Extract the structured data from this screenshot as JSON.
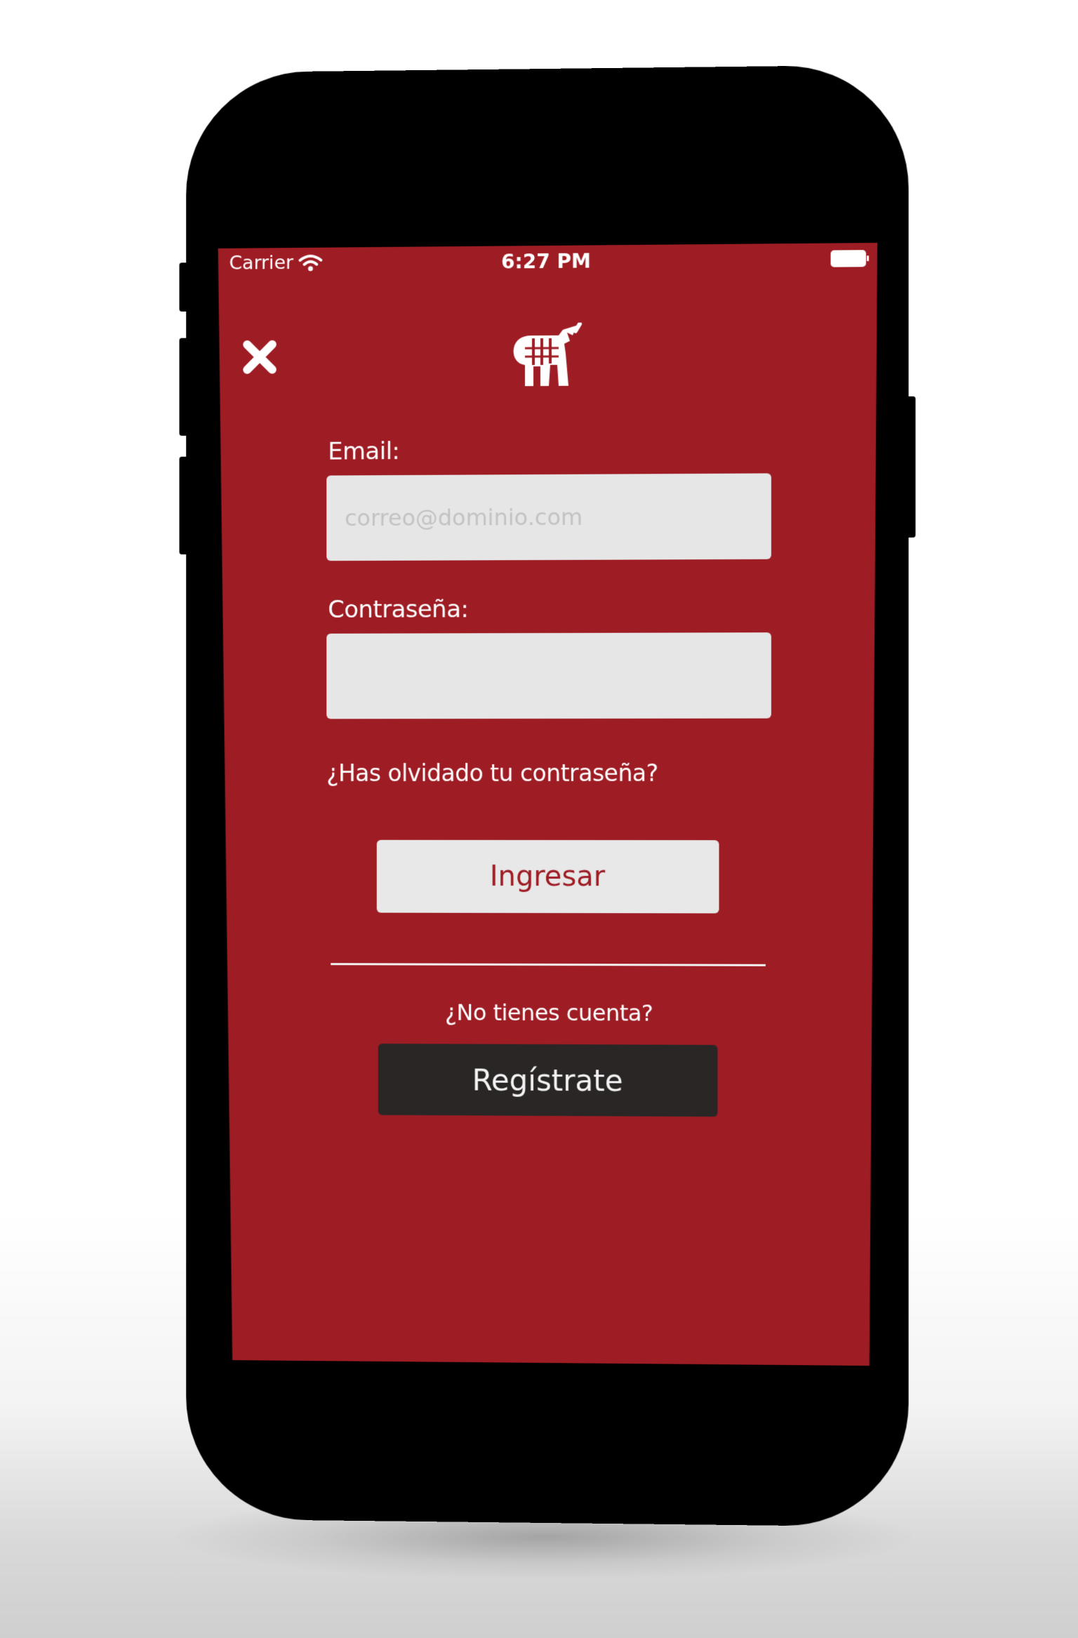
{
  "status_bar": {
    "carrier": "Carrier",
    "time": "6:27 PM"
  },
  "header": {
    "close_icon": "close-icon",
    "logo_icon": "cow-logo-icon"
  },
  "login_form": {
    "email_label": "Email:",
    "email_placeholder": "correo@dominio.com",
    "email_value": "",
    "password_label": "Contraseña:",
    "password_value": "",
    "forgot_password": "¿Has olvidado tu contraseña?",
    "login_button": "Ingresar"
  },
  "register": {
    "prompt": "¿No tienes cuenta?",
    "register_button": "Regístrate"
  },
  "colors": {
    "background": "#9e1c24",
    "input_bg": "#e6e6e6",
    "login_text": "#9e1c24",
    "register_bg": "#2b2626"
  }
}
